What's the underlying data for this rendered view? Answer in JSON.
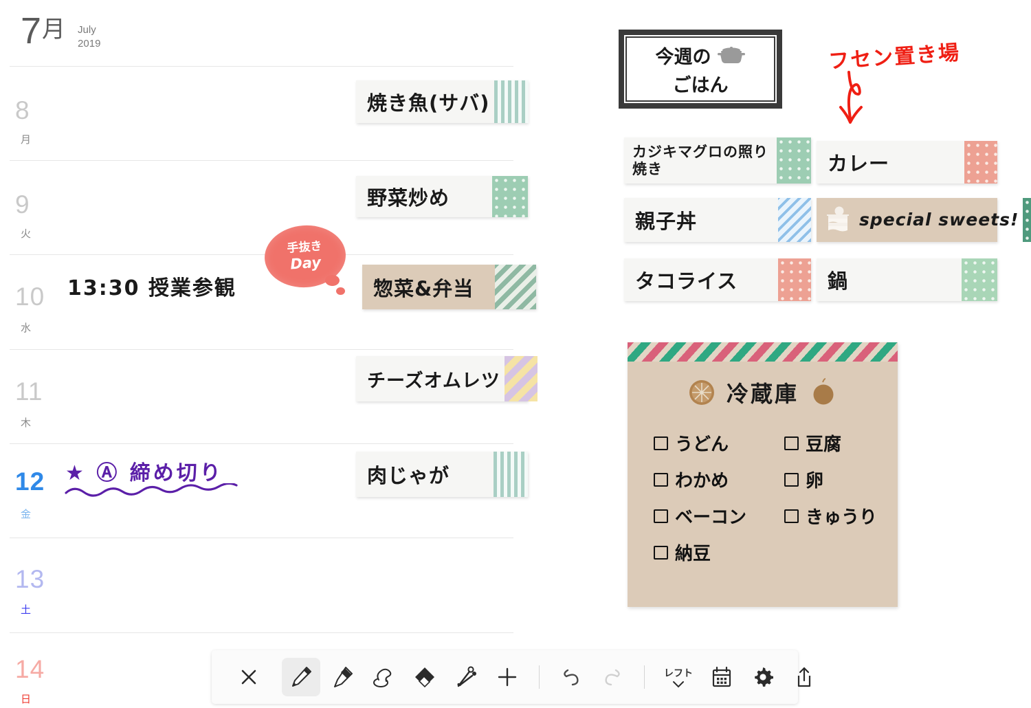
{
  "calendar": {
    "month_number": "7",
    "month_kanji": "月",
    "month_en": "July",
    "year": "2019",
    "days": [
      {
        "num": "8",
        "dow": "月",
        "event": "",
        "meal": "焼き魚(サバ)",
        "tape": "vertical-stripe-green"
      },
      {
        "num": "9",
        "dow": "火",
        "event": "",
        "meal": "野菜炒め",
        "tape": "dots-green"
      },
      {
        "num": "10",
        "dow": "水",
        "event": "13:30 授業参観",
        "meal": "惣菜&弁当",
        "tape": "diagonal-green",
        "stamp_line1": "手抜き",
        "stamp_line2": "Day"
      },
      {
        "num": "11",
        "dow": "木",
        "event": "",
        "meal": "チーズオムレツ",
        "tape": "diagonal-yellow-purple"
      },
      {
        "num": "12",
        "dow": "金",
        "event": "★ Ⓐ 締め切り",
        "meal": "肉じゃが",
        "tape": "vertical-stripe-green"
      },
      {
        "num": "13",
        "dow": "土",
        "event": "",
        "meal": "",
        "tape": ""
      },
      {
        "num": "14",
        "dow": "日",
        "event": "",
        "meal": "",
        "tape": ""
      }
    ]
  },
  "panel": {
    "title_line1": "今週の",
    "title_line2": "ごはん",
    "title_icon": "pot-icon",
    "red_note": "フセン置き場",
    "red_arrow": "down-arrow-icon",
    "notes": [
      {
        "text": "カジキマグロの照り焼き",
        "tape": "dots-green",
        "style": "white"
      },
      {
        "text": "カレー",
        "tape": "dots-pink",
        "style": "white"
      },
      {
        "text": "親子丼",
        "tape": "diagonal-blue",
        "style": "white"
      },
      {
        "text": "special sweets!",
        "tape": "dots-green-dark",
        "style": "beige",
        "icon": "cake-icon"
      },
      {
        "text": "タコライス",
        "tape": "dots-pink",
        "style": "white"
      },
      {
        "text": "鍋",
        "tape": "dots-green-light",
        "style": "white"
      }
    ],
    "fridge": {
      "title": "冷蔵庫",
      "icon_left": "orange-slice-icon",
      "icon_right": "apple-icon",
      "items": [
        [
          "うどん",
          "豆腐"
        ],
        [
          "わかめ",
          "卵"
        ],
        [
          "ベーコン",
          "きゅうり"
        ],
        [
          "納豆",
          ""
        ]
      ]
    }
  },
  "toolbar": {
    "close": "close-icon",
    "pencil": "pencil-icon",
    "marker": "marker-icon",
    "stamp": "stamp-icon",
    "eraser": "eraser-icon",
    "scissors": "scissors-icon",
    "add": "plus-icon",
    "undo": "undo-icon",
    "redo": "redo-icon",
    "layout_label": "レフト",
    "calendar": "calendar-icon",
    "settings": "gear-icon",
    "share": "share-icon"
  },
  "colors": {
    "today_blue": "#2f89e8",
    "saturday": "#3c3cf0",
    "sunday": "#ef3b32",
    "red_ink": "#ef1f14",
    "purple_ink": "#5b1fa8",
    "stamp_coral": "#f0726a",
    "beige_note": "#dccbb8"
  }
}
